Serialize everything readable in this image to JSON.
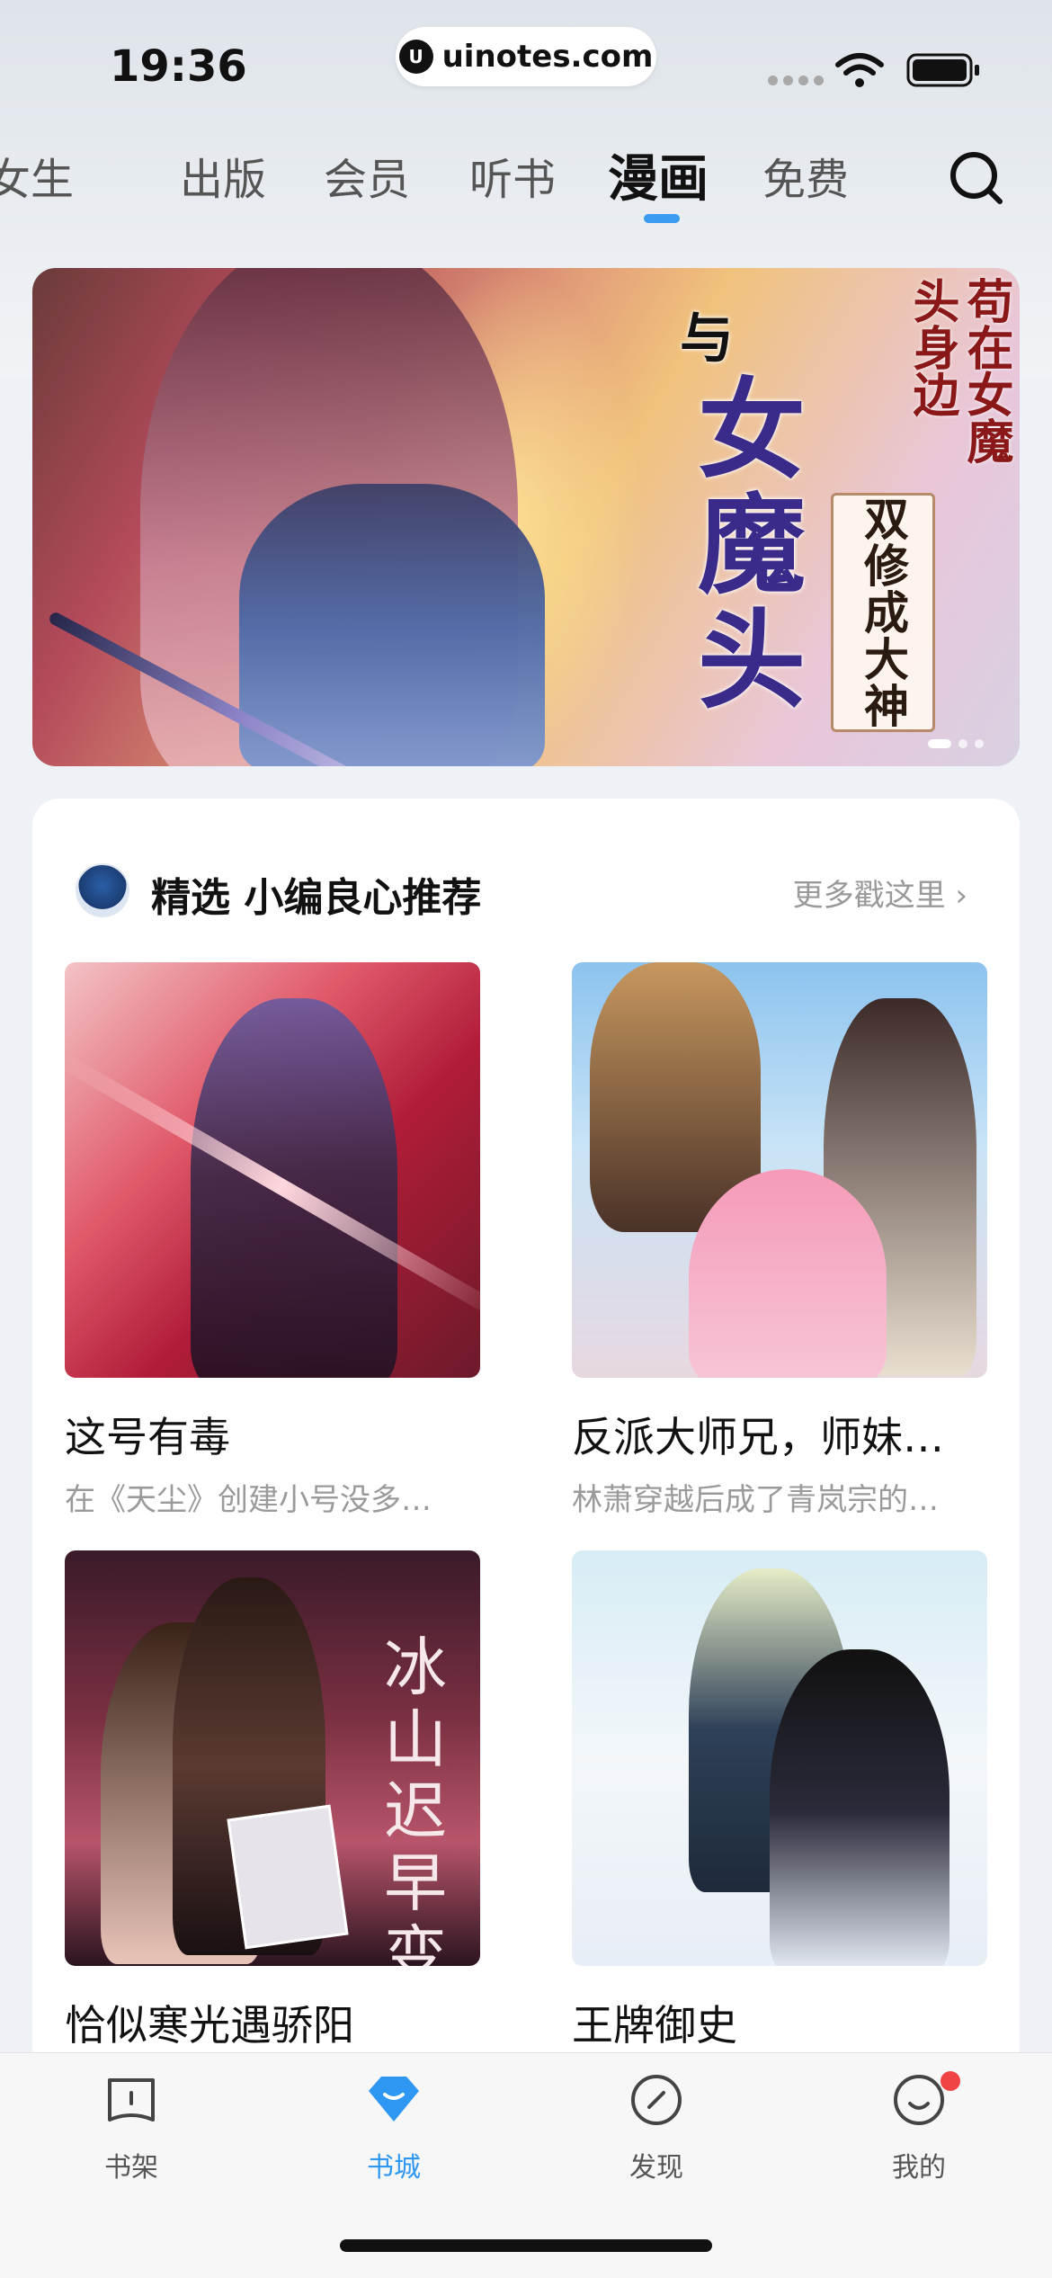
{
  "status_bar": {
    "time": "19:36",
    "url": "uinotes.com"
  },
  "top_tabs": {
    "items": [
      "女生",
      "出版",
      "会员",
      "听书",
      "漫画",
      "免费"
    ],
    "active": "漫画"
  },
  "banner": {
    "title_small": "与",
    "title_big": "女魔头",
    "subtitle": "双修成大神",
    "logo_text": "苟在女魔头身边"
  },
  "featured": {
    "title": "精选 小编良心推荐",
    "more": "更多戳这里 ›",
    "books": [
      {
        "title": "这号有毒",
        "desc": "在《天尘》创建小号没多…"
      },
      {
        "title": "反派大师兄，师妹…",
        "desc": "林萧穿越后成了青岚宗的…"
      },
      {
        "title": "恰似寒光遇骄阳",
        "desc": "",
        "cover_text": "冰山迟早变妻奴"
      },
      {
        "title": "王牌御史",
        "desc": ""
      }
    ]
  },
  "bottom_nav": {
    "items": [
      {
        "label": "书架",
        "icon": "bookshelf-icon"
      },
      {
        "label": "书城",
        "icon": "bookstore-icon"
      },
      {
        "label": "发现",
        "icon": "compass-icon"
      },
      {
        "label": "我的",
        "icon": "smile-icon"
      }
    ],
    "active": "书城"
  },
  "colors": {
    "accent": "#2e97f2",
    "badge": "#f04444"
  }
}
